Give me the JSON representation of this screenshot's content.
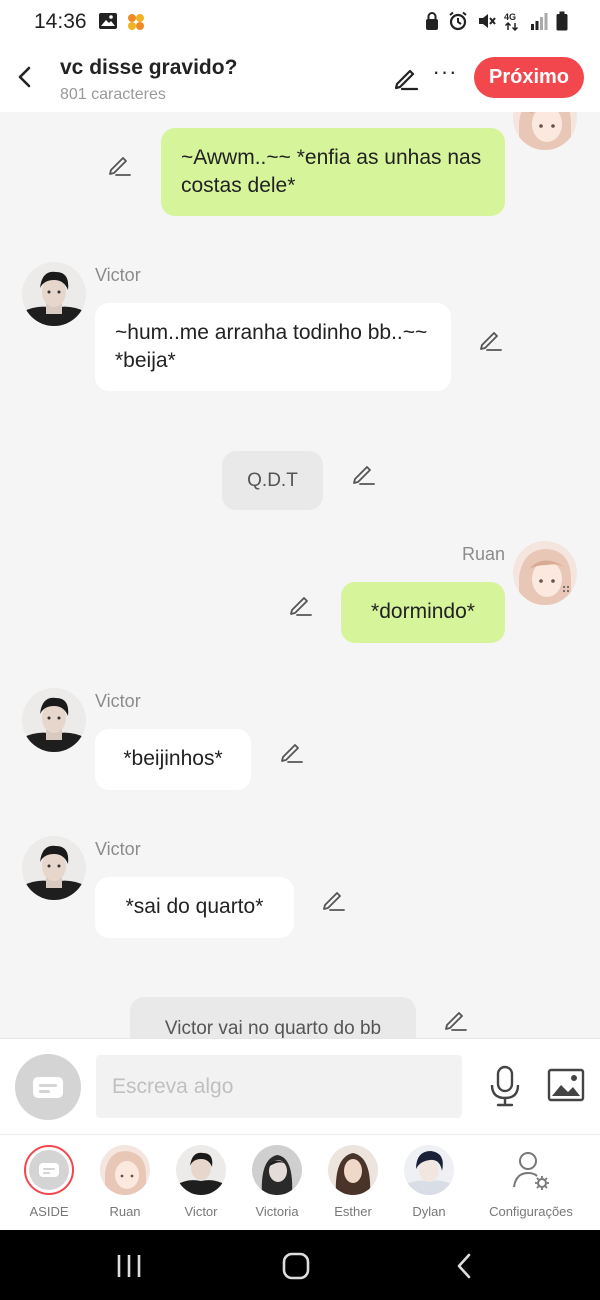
{
  "status": {
    "time": "14:36",
    "icons": [
      "image-icon",
      "app-notification-icon",
      "lock-icon",
      "alarm-icon",
      "mute-icon",
      "4g-icon",
      "signal-icon",
      "battery-icon"
    ]
  },
  "header": {
    "title": "vc disse gravido?",
    "subtitle": "801 caracteres",
    "next_label": "Próximo"
  },
  "messages": [
    {
      "side": "mine",
      "text": "~Awwm..~~ *enfia as unhas nas costas dele*"
    },
    {
      "side": "theirs",
      "sender": "Victor",
      "text": "~hum..me arranha todinho bb..~~ *beija*"
    },
    {
      "side": "narration",
      "text": "Q.D.T"
    },
    {
      "side": "mine",
      "sender": "Ruan",
      "text": "*dormindo*"
    },
    {
      "side": "theirs",
      "sender": "Victor",
      "text": "*beijinhos*"
    },
    {
      "side": "theirs",
      "sender": "Victor",
      "text": "*sai do quarto*"
    },
    {
      "side": "narration",
      "text": "Victor vai no quarto do bb"
    }
  ],
  "input": {
    "placeholder": "Escreva algo"
  },
  "characters": [
    {
      "name": "ASIDE"
    },
    {
      "name": "Ruan"
    },
    {
      "name": "Victor"
    },
    {
      "name": "Victoria"
    },
    {
      "name": "Esther"
    },
    {
      "name": "Dylan"
    },
    {
      "name": "Configurações"
    }
  ],
  "colors": {
    "accent": "#f2474d",
    "my_bubble": "#d6f59b",
    "their_bubble": "#ffffff",
    "narration_bubble": "#e9e9e9"
  }
}
